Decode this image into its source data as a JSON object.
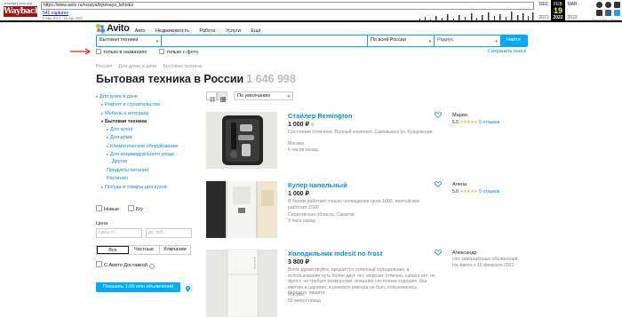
{
  "wayback": {
    "logo_tagline": "INTERNET ARCHIVE",
    "logo_text": "WaybackMachine",
    "url": "https://www.avito.ru/rossiya/bytovaya_tehnika",
    "captures": "541 captures",
    "range": "3 Mar 2012 - 22 Apr 2022",
    "months": [
      {
        "month": "DEC",
        "day": "",
        "year": "2021"
      },
      {
        "month": "FEB",
        "day": "19",
        "year": "2022"
      },
      {
        "month": "MAR",
        "day": "",
        "year": "2022"
      }
    ],
    "about": "About this capture"
  },
  "header": {
    "logo": "Avito",
    "nav": [
      "Авто",
      "Недвижимость",
      "Работа",
      "Услуги",
      "Ещё"
    ]
  },
  "search": {
    "category": "Бытовая техника",
    "query": "",
    "region": "По всей России",
    "radius": "Радиус",
    "button": "Найти",
    "only_titles": "только в названиях",
    "only_photo": "только с фото",
    "save": "Сохранить поиск"
  },
  "breadcrumbs": [
    "Россия",
    "Для дома и дачи",
    "Бытовая техника"
  ],
  "page": {
    "title": "Бытовая техника в России",
    "count": "1 646 998"
  },
  "sidebar": {
    "items": [
      {
        "label": "Для дома и дачи",
        "level": 0,
        "bold": false
      },
      {
        "label": "Ремонт и строительство",
        "level": 1,
        "bold": false
      },
      {
        "label": "Мебель и интерьер",
        "level": 1,
        "bold": false
      },
      {
        "label": "Бытовая техника",
        "level": 1,
        "bold": true
      },
      {
        "label": "Для кухни",
        "level": 2,
        "bold": false
      },
      {
        "label": "Для дома",
        "level": 2,
        "bold": false
      },
      {
        "label": "Климатическое оборудование",
        "level": 2,
        "bold": false
      },
      {
        "label": "Для индивидуального ухода",
        "level": 2,
        "bold": false
      },
      {
        "label": "Другое",
        "level": 2,
        "bold": false
      },
      {
        "label": "Продукты питания",
        "level": 1,
        "bold": false
      },
      {
        "label": "Растения",
        "level": 1,
        "bold": false
      },
      {
        "label": "Посуда и товары для кухни",
        "level": 1,
        "bold": false
      }
    ],
    "new": "Новые",
    "used": "Б/у",
    "price_label": "Цена",
    "price_from": "Цена от",
    "price_to": "до, руб.",
    "seller_types": [
      "Все",
      "Частные",
      "Компании"
    ],
    "delivery": "С Авито Доставкой",
    "show_button": "Показать 1,65 млн объявлений"
  },
  "sort": {
    "value": "По умолчанию"
  },
  "listings": [
    {
      "title": "Стайлер Remington",
      "price": "1 000 ₽",
      "price_note": "Ф",
      "desc": "Состояние отличное. Полный комплект. Самовывоз ул. Кунцевская.",
      "city": "Москва",
      "time": "6 часов назад",
      "seller": "Мария",
      "rating": "5.0",
      "stars": "★★★★★",
      "reviews": "5 отзывов",
      "seller_extra": ""
    },
    {
      "title": "Кулер напольный",
      "price": "1 000 ₽",
      "price_note": "",
      "desc": "В белом работает только охлаждение цена 1000, желтый все работает 1500",
      "city": "Саратовская область, Саратов",
      "time": "3 часа назад",
      "seller": "Алена",
      "rating": "5.0",
      "stars": "★★★★★",
      "reviews": "5 отзывов",
      "seller_extra": ""
    },
    {
      "title": "Холодильник indesit no frost",
      "price": "3 800 ₽",
      "price_note": "",
      "desc": "Всем здравствуйте, продаётся отличный холодильник, в использовании чуть более двух лет, морозит отлично, сапаха нет, но фрост, не требует разморозки, внешнее состояние хорошее, без вмятин и царапин, в ремонте никогда не был, пользовались бережно, пишите",
      "city": "Москва",
      "time": "59 минут назад",
      "seller": "Александр",
      "rating": "",
      "stars": "",
      "reviews": "Нет завершённых объявлений",
      "seller_extra": "На Авито с 15 февраля 2022"
    }
  ],
  "colors": {
    "accent": "#00aaff",
    "link": "#0091d9",
    "star": "#ffb021",
    "wb_red": "#aa1111"
  }
}
